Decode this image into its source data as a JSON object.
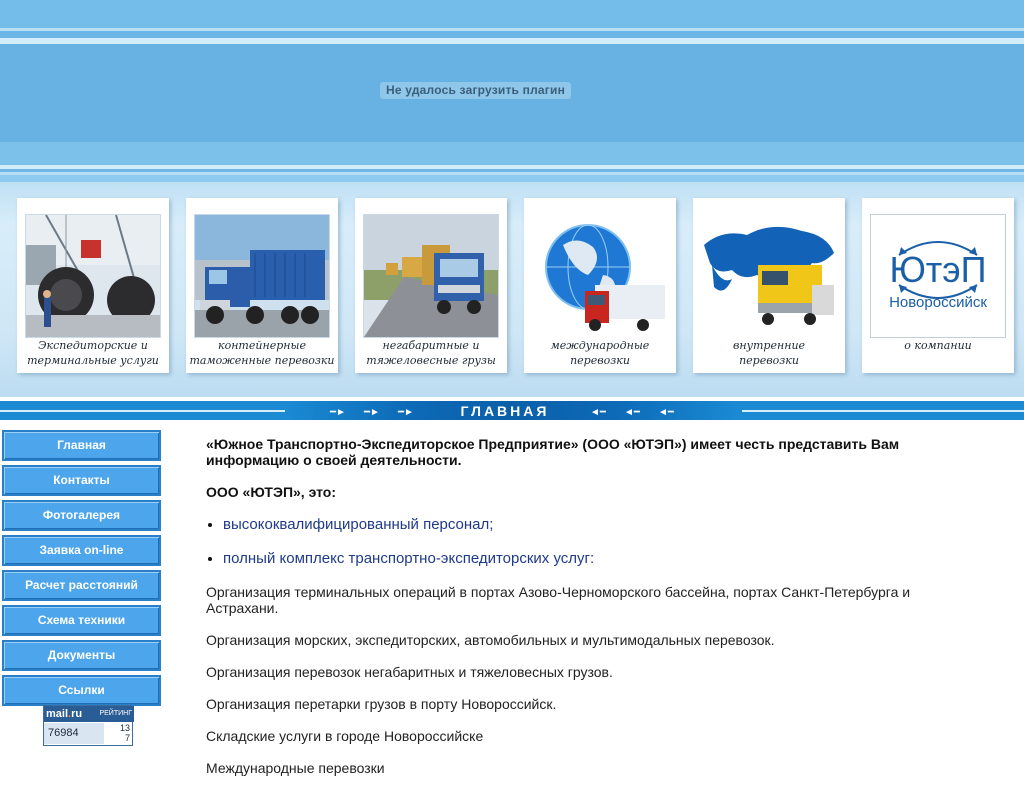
{
  "banner": {
    "plugin_message": "Не удалось загрузить плагин"
  },
  "cards": [
    {
      "line1": "Экспедиторские и",
      "line2": "терминальные услуги"
    },
    {
      "line1": "контейнерные",
      "line2": "таможенные перевозки"
    },
    {
      "line1": "негабаритные и",
      "line2": "тяжеловесные грузы"
    },
    {
      "line1": "международные",
      "line2": "перевозки"
    },
    {
      "line1": "внутренние",
      "line2": "перевозки"
    },
    {
      "line1": "",
      "line2": "о компании",
      "logo_main": "ЮтэП",
      "logo_sub": "Новороссийск"
    }
  ],
  "nav": {
    "title": "ГЛАВНАЯ"
  },
  "sidebar": {
    "items": [
      {
        "label": "Главная"
      },
      {
        "label": "Контакты"
      },
      {
        "label": "Фотогалерея"
      },
      {
        "label": "Заявка on-line"
      },
      {
        "label": "Расчет расстояний"
      },
      {
        "label": "Схема техники"
      },
      {
        "label": "Документы"
      },
      {
        "label": "Ссылки"
      }
    ]
  },
  "counter": {
    "brand_mail": "mail",
    "brand_dot": ".",
    "brand_ru": "ru",
    "rating_label": "РЕЙТИНГ",
    "count": "76984",
    "small_top": "13",
    "small_bottom": "7"
  },
  "content": {
    "intro": "«Южное Транспортно-Экспедиторское Предприятие» (ООО «ЮТЭП») имеет честь представить Вам информацию о своей деятельности.",
    "lead": "ООО «ЮТЭП», это:",
    "bullets": [
      "высококвалифицированный персонал;",
      "полный комплекс транспортно-экспедиторских услуг:"
    ],
    "paragraphs": [
      "Организация терминальных операций в портах Азово-Черноморского бассейна, портах Санкт-Петербурга и Астрахани.",
      "Организация морских, экспедиторских, автомобильных и мультимодальных перевозок.",
      "Организация перевозок негабаритных и тяжеловесных грузов.",
      "Организация перетарки грузов в порту Новороссийск.",
      "Складские услуги в городе Новороссийске",
      "Международные перевозки"
    ]
  },
  "colors": {
    "banner_blue": "#6bb6e6",
    "nav_blue": "#1a8ad3",
    "menu_blue": "#4da6ec",
    "bullet_link": "#1f3a8a"
  }
}
